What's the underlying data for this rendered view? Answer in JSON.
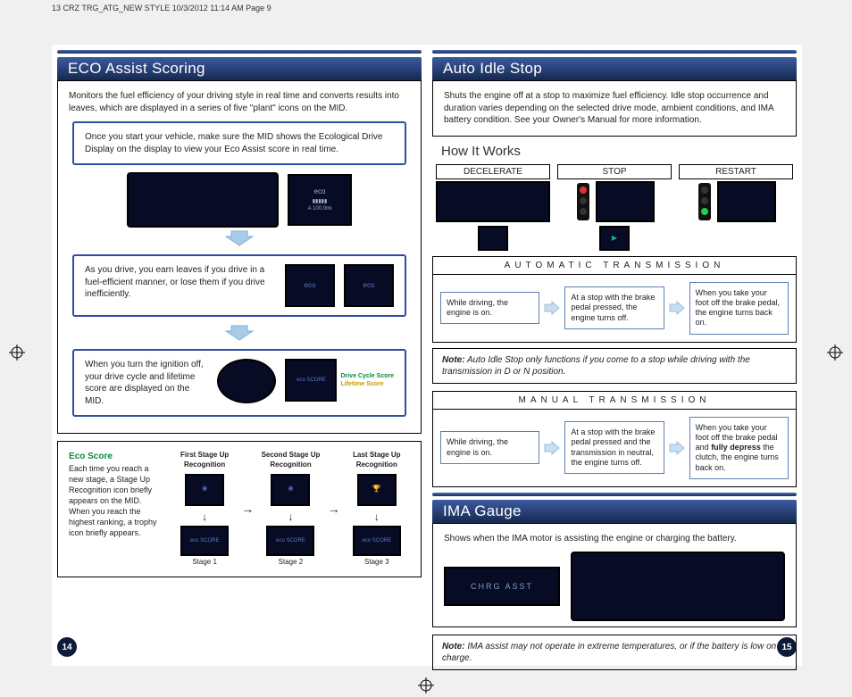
{
  "header_strip": "13 CRZ TRG_ATG_NEW STYLE  10/3/2012  11:14 AM  Page 9",
  "left": {
    "title": "ECO Assist Scoring",
    "intro": "Monitors the fuel efficiency of your driving style in real time and converts results into leaves, which are displayed in a series of five \"plant\" icons on the MID.",
    "c1": "Once you start your vehicle, make sure the MID shows the Ecological Drive Display on the display to view your Eco Assist score in real time.",
    "c2": "As you drive, you earn leaves if you drive in a fuel-efficient manner, or lose them if you drive inefficiently.",
    "c3": "When you turn the ignition off, your drive cycle and lifetime score are displayed on the MID.",
    "score_label1": "Drive Cycle Score",
    "score_label2": "Lifetime Score",
    "eco_title": "Eco Score",
    "eco_text": "Each time you reach a new stage, a Stage Up Recognition icon briefly appears on the MID. When you reach the highest ranking, a trophy icon briefly appears.",
    "stage_caps": [
      "First Stage Up Recognition",
      "Second Stage Up Recognition",
      "Last Stage Up Recognition"
    ],
    "stages": [
      "Stage 1",
      "Stage 2",
      "Stage 3"
    ],
    "pg": "14"
  },
  "right": {
    "title1": "Auto Idle Stop",
    "intro1": "Shuts the engine off at a stop to maximize fuel efficiency. Idle stop occurrence and duration varies depending on the selected drive mode, ambient conditions, and IMA battery condition. See your Owner's Manual for more information.",
    "how": "How It Works",
    "how_labels": [
      "DECELERATE",
      "STOP",
      "RESTART"
    ],
    "auto_head": "AUTOMATIC TRANSMISSION",
    "auto": [
      "While driving, the engine is on.",
      "At a stop with the brake pedal pressed, the engine turns off.",
      "When you take your foot off the brake pedal, the engine turns back on."
    ],
    "note1a": "Note:",
    "note1b": " Auto Idle Stop only functions if you come to a stop while driving with the transmission in D or N position.",
    "man_head": "MANUAL TRANSMISSION",
    "man_a": "While driving, the engine is on.",
    "man_b": "At a stop with the brake pedal pressed and the transmission in neutral, the engine turns off.",
    "man_c1": "When you take your foot off the brake pedal and ",
    "man_c2": "fully depress",
    "man_c3": " the clutch, the engine turns back on.",
    "title2": "IMA Gauge",
    "intro2": "Shows when the IMA motor is assisting the engine or charging the battery.",
    "ima_display": "CHRG     ASST",
    "note2a": "Note:",
    "note2b": " IMA assist may not operate in extreme temperatures, or if the battery is low on charge.",
    "pg": "15"
  }
}
